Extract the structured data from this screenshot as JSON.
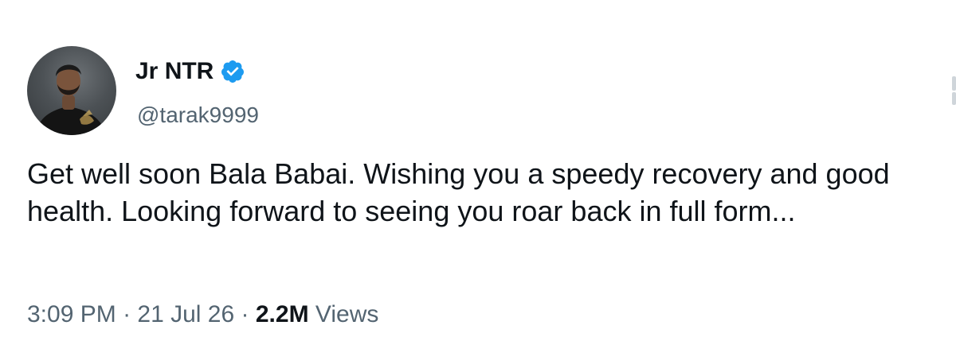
{
  "author": {
    "name": "Jr NTR",
    "handle": "@tarak9999",
    "verified": true
  },
  "tweet": {
    "text": "Get well soon Bala Babai. Wishing you a speedy recovery and good health. Looking forward to seeing you roar back in full form..."
  },
  "meta": {
    "time": "3:09 PM",
    "separator": "·",
    "date": "21 Jul 26",
    "views_count": "2.2M",
    "views_label": "Views"
  },
  "icons": {
    "avatar": "profile-photo",
    "badge": "verified-badge-icon"
  },
  "colors": {
    "text": "#0f1419",
    "secondary": "#536471",
    "verified": "#1d9bf0"
  }
}
